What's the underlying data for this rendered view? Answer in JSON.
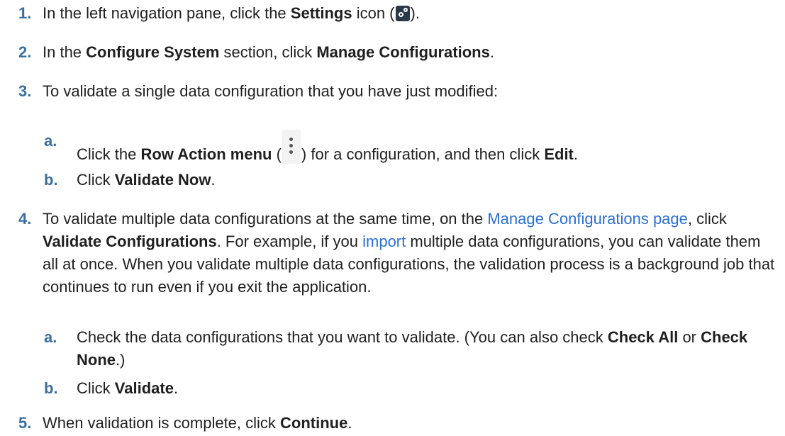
{
  "steps": [
    {
      "num": "1.",
      "t1": "In the left navigation pane, click the ",
      "b1": "Settings",
      "t2": " icon (",
      "t3": ")."
    },
    {
      "num": "2.",
      "t1": "In the ",
      "b1": "Configure System",
      "t2": " section, click ",
      "b2": "Manage Configurations",
      "t3": "."
    },
    {
      "num": "3.",
      "t1": "To validate a single data configuration that you have just modified:",
      "subs": [
        {
          "num": "a.",
          "t1": "Click the ",
          "b1": "Row Action menu",
          "t2": " (",
          "t3": ") for a configuration, and then click ",
          "b2": "Edit",
          "t4": "."
        },
        {
          "num": "b.",
          "t1": "Click ",
          "b1": "Validate Now",
          "t2": "."
        }
      ]
    },
    {
      "num": "4.",
      "t1": "To validate multiple data configurations at the same time, on the ",
      "link1": "Manage Configurations page",
      "t2": ", click ",
      "b1": "Validate Configurations",
      "t3": ". For example, if you ",
      "link2": "import",
      "t4": " multiple data configurations, you can validate them all at once. When you validate multiple data configurations, the validation process is a background job that continues to run even if you exit the application.",
      "subs": [
        {
          "num": "a.",
          "t1": "Check the data configurations that you want to validate. (You can also check ",
          "b1": "Check All",
          "t2": " or ",
          "b2": "Check None",
          "t3": ".)"
        },
        {
          "num": "b.",
          "t1": "Click ",
          "b1": "Validate",
          "t2": "."
        }
      ]
    },
    {
      "num": "5.",
      "t1": "When validation is complete, click ",
      "b1": "Continue",
      "t2": "."
    }
  ],
  "icons": {
    "settings": "settings-gear-icon",
    "row_action": "vertical-ellipsis-icon"
  },
  "colors": {
    "step_number": "#3a6f9e",
    "link": "#2a6fd4"
  }
}
